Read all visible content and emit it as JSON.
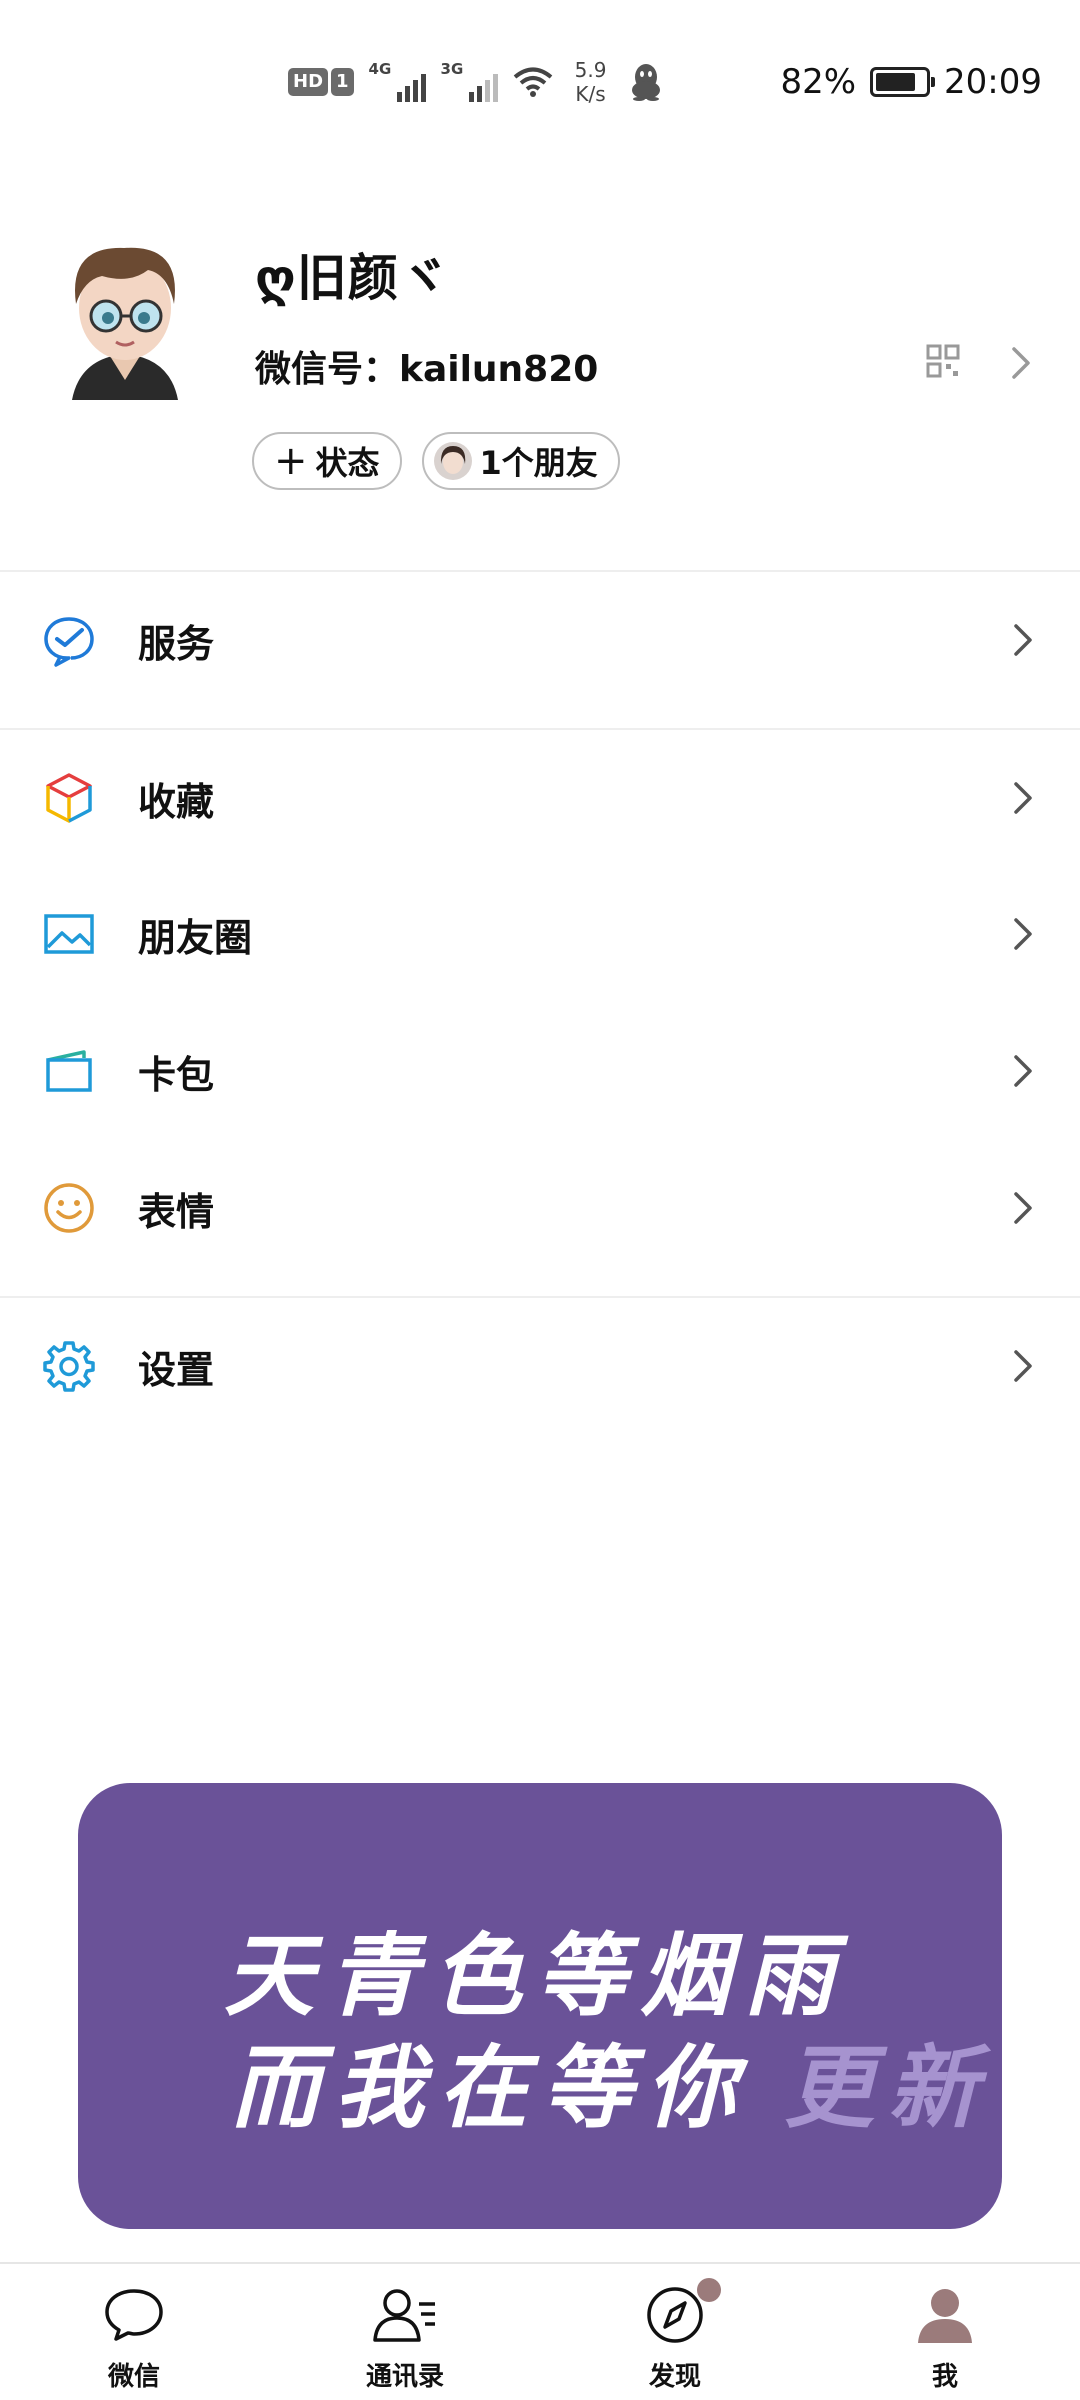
{
  "status_bar": {
    "hd_label": "HD",
    "sim_label": "1",
    "net1": "4G",
    "net2": "3G",
    "speed_value": "5.9",
    "speed_unit": "K/s",
    "battery_percent": "82%",
    "battery_level": 0.82,
    "time": "20:09"
  },
  "profile": {
    "nickname": "ღ旧颜ヾ",
    "wechat_id_label": "微信号：kailun820",
    "status_button": "状态",
    "friends_button": "1个朋友"
  },
  "menu": {
    "services": "服务",
    "favorites": "收藏",
    "moments": "朋友圈",
    "cards": "卡包",
    "stickers": "表情",
    "settings": "设置"
  },
  "banner": {
    "line1": "天青色等烟雨",
    "line2": "而我在等你",
    "update": "更新"
  },
  "tabbar": {
    "chats": "微信",
    "contacts": "通讯录",
    "discover": "发现",
    "me": "我"
  },
  "colors": {
    "banner_bg": "#6a5298",
    "icon_blue": "#1f7ad8",
    "sticker_orange": "#e09a3a"
  }
}
